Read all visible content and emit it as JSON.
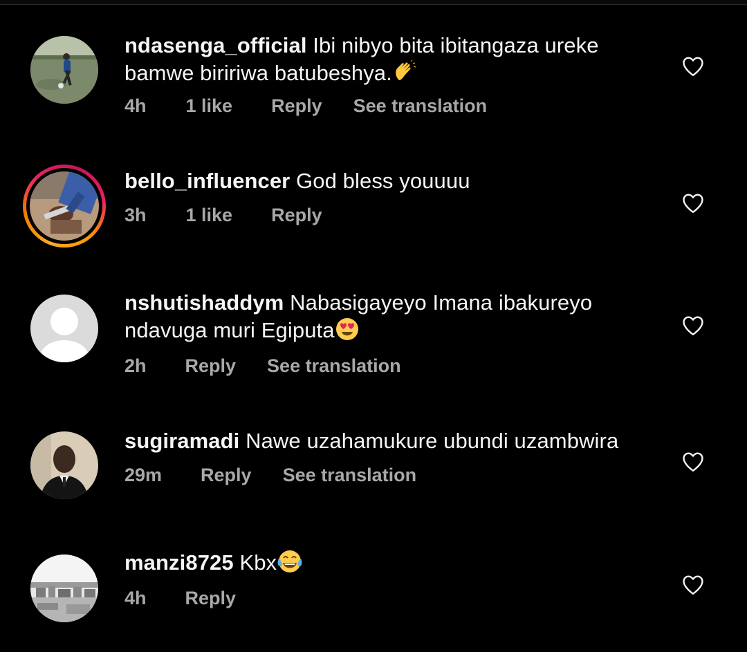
{
  "comments": [
    {
      "username": "ndasenga_official",
      "text": "Ibi nibyo bita ibitangaza ureke bamwe biririwa batubeshya.",
      "emoji": "clapping-hand",
      "time": "4h",
      "likes": "1 like",
      "reply": "Reply",
      "translation": "See translation"
    },
    {
      "username": "bello_influencer",
      "text": "God bless youuuu",
      "time": "3h",
      "likes": "1 like",
      "reply": "Reply"
    },
    {
      "username": "nshutishaddym",
      "text": "Nabasigayeyo Imana ibakureyo ndavuga muri Egiputa",
      "emoji": "heart-eyes",
      "time": "2h",
      "reply": "Reply",
      "translation": "See translation"
    },
    {
      "username": "sugiramadi",
      "text": "Nawe uzahamukure ubundi uzambwira",
      "time": "29m",
      "reply": "Reply",
      "translation": "See translation"
    },
    {
      "username": "manzi8725",
      "text": "Kbx",
      "emoji": "tears-of-joy",
      "time": "4h",
      "reply": "Reply"
    }
  ],
  "colors": {
    "background": "#000000",
    "text": "#f5f5f5",
    "meta": "#a8a8a8",
    "story_ring": [
      "#f9a825",
      "#e91e63"
    ]
  },
  "icons": {
    "like": "heart-outline-icon"
  }
}
